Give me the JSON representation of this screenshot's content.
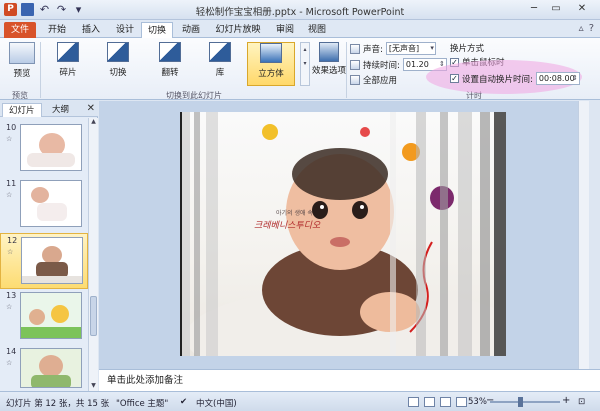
{
  "window": {
    "title": "轻松制作宝宝相册.pptx - Microsoft PowerPoint",
    "app_letter": "P"
  },
  "tabs": [
    "文件",
    "开始",
    "插入",
    "设计",
    "切换",
    "动画",
    "幻灯片放映",
    "审阅",
    "视图"
  ],
  "active_tab": "切换",
  "ribbon": {
    "preview_label": "预览",
    "preview_group": "预览",
    "transitions": [
      "碎片",
      "切换",
      "翻转",
      "库",
      "立方体"
    ],
    "selected_transition": "立方体",
    "effect_options_label": "效果选项",
    "transition_group": "切换到此幻灯片",
    "sound_label": "声音:",
    "sound_value": "[无声音]",
    "duration_label": "持续时间:",
    "duration_value": "01.20",
    "apply_all_label": "全部应用",
    "advance_title": "换片方式",
    "on_click_label": "单击鼠标时",
    "on_click_checked": true,
    "auto_advance_label": "设置自动换片时间:",
    "auto_advance_checked": true,
    "auto_advance_value": "00:08.00",
    "timing_group": "计时"
  },
  "left_pane": {
    "tab_slides": "幻灯片",
    "tab_outline": "大纲",
    "close": "✕",
    "slides": [
      {
        "num": "10",
        "selected": false
      },
      {
        "num": "11",
        "selected": false
      },
      {
        "num": "12",
        "selected": true
      },
      {
        "num": "13",
        "selected": false
      },
      {
        "num": "14",
        "selected": false
      }
    ]
  },
  "slide": {
    "korean_text_1": "아기의 생애 속",
    "korean_text_2": "크레베니스투디오"
  },
  "notes_placeholder": "单击此处添加备注",
  "status": {
    "slide_info": "幻灯片 第 12 张，共 15 张",
    "theme": "\"Office 主题\"",
    "language": "中文(中国)",
    "zoom": "53%"
  },
  "colors": {
    "file_tab": "#d8532a",
    "selection": "#fddc72",
    "highlight": "#f1a4e2"
  }
}
